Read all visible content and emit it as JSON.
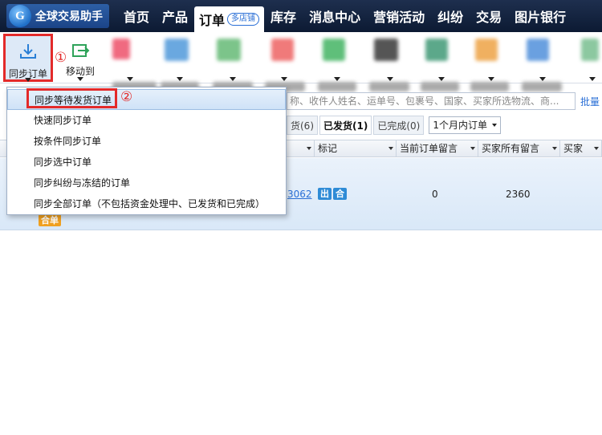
{
  "app": {
    "title": "全球交易助手"
  },
  "nav": {
    "items": [
      "首页",
      "产品",
      "订单",
      "库存",
      "消息中心",
      "营销活动",
      "纠纷",
      "交易",
      "图片银行"
    ],
    "active_badge": "多店铺"
  },
  "toolbar": {
    "sync_label": "同步订单",
    "move_label": "移动到",
    "step1": "①",
    "step2": "②"
  },
  "menu": {
    "items": [
      "同步等待发货订单",
      "快速同步订单",
      "按条件同步订单",
      "同步选中订单",
      "同步纠纷与冻结的订单",
      "同步全部订单（不包括资金处理中、已发货和已完成）"
    ]
  },
  "search": {
    "placeholder": "称、收件人姓名、运单号、包裹号、国家、买家所选物流、商...",
    "bulk_label": "批量"
  },
  "tabs": [
    {
      "label": "货(6)"
    },
    {
      "label": "已发货(1)"
    },
    {
      "label": "已完成(0)"
    }
  ],
  "period": {
    "value": "1个月内订单"
  },
  "table": {
    "headers": [
      "标记",
      "当前订单留言",
      "买家所有留言",
      "买家"
    ],
    "row": {
      "order_fragment": "3062",
      "tag1": "出",
      "tag2": "合",
      "tag3": "合单",
      "current_msg": "0",
      "all_msg": "2360"
    }
  },
  "colors": {
    "accent": "#2a6fd6",
    "highlight": "#e32a2a",
    "nav_bg": "#132442"
  }
}
